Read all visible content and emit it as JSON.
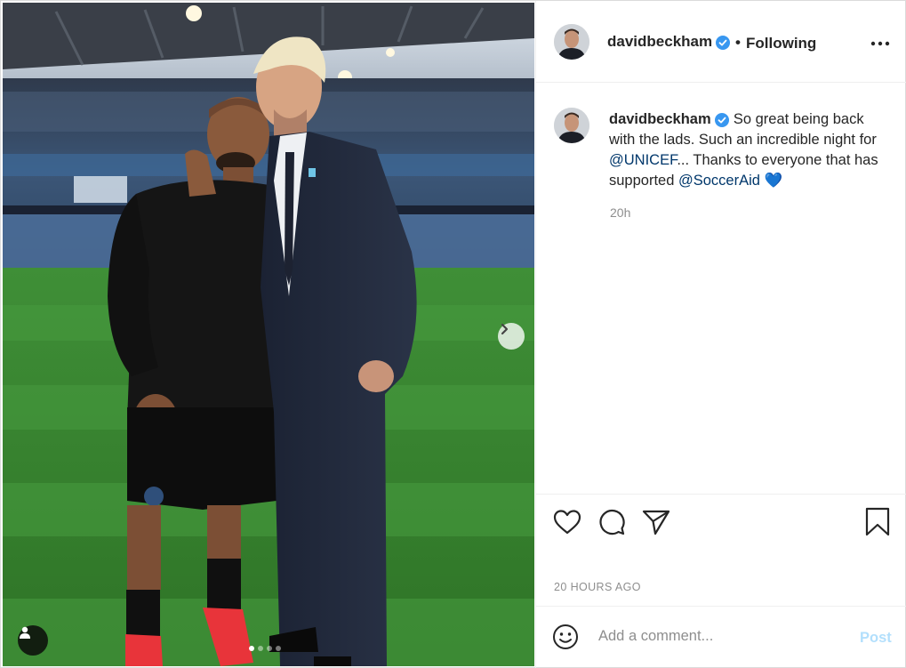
{
  "post": {
    "username": "davidbeckham",
    "follow_status": "Following",
    "separator": "•",
    "more_icon": "more-horizontal-icon",
    "caption": {
      "username": "davidbeckham",
      "text_1": "So great being back with the lads. Such an incredible night for ",
      "mention_1": "@UNICEF",
      "text_2": "... Thanks to everyone that has supported ",
      "mention_2": "@SoccerAid",
      "heart_emoji": "💙"
    },
    "caption_time": "20h",
    "posted_ago": "20 HOURS AGO",
    "carousel": {
      "total": 4,
      "active": 1
    }
  },
  "comment": {
    "placeholder": "Add a comment...",
    "post_label": "Post"
  },
  "colors": {
    "verified": "#3897f0",
    "mention": "#00376b",
    "post_disabled": "#b2dffc",
    "muted": "#8e8e8e"
  }
}
